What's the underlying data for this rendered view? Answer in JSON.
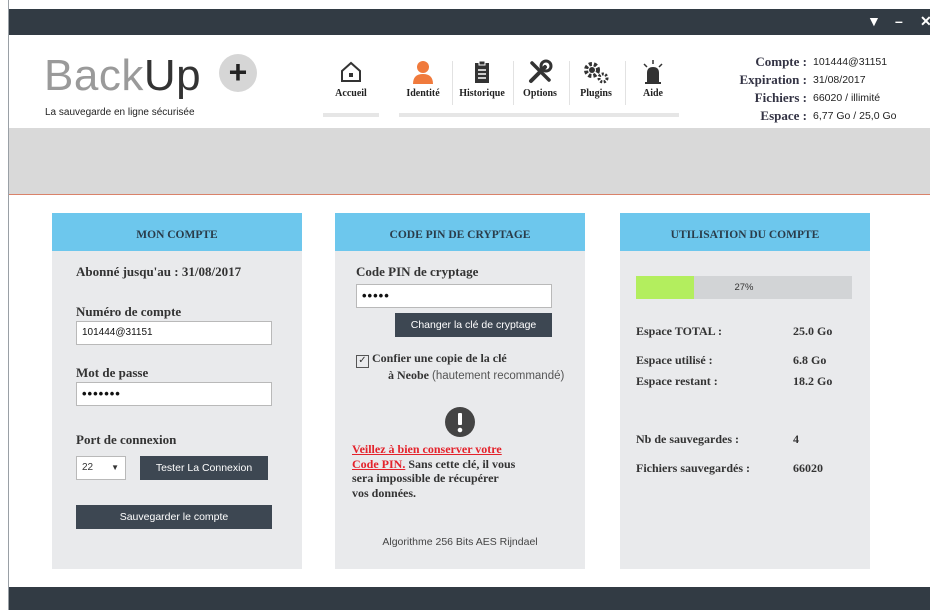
{
  "window": {
    "controls": [
      "▼",
      "–",
      "✕"
    ]
  },
  "app": {
    "name_light": "Back",
    "name_dark": "Up",
    "plus": "+",
    "tagline": "La sauvegarde en ligne sécurisée"
  },
  "nav": {
    "items": [
      {
        "label": "Accueil",
        "icon": "home-icon"
      },
      {
        "label": "Identité",
        "icon": "user-icon",
        "color": "#f07a3c"
      },
      {
        "label": "Historique",
        "icon": "clipboard-icon"
      },
      {
        "label": "Options",
        "icon": "tools-icon"
      },
      {
        "label": "Plugins",
        "icon": "gears-icon"
      },
      {
        "label": "Aide",
        "icon": "alarm-light-icon"
      }
    ]
  },
  "account_info": {
    "compte_label": "Compte :",
    "compte_value": "101444@31151",
    "expiration_label": "Expiration :",
    "expiration_value": "31/08/2017",
    "fichiers_label": "Fichiers :",
    "fichiers_value": "66020 / illimité",
    "espace_label": "Espace :",
    "espace_value": "6,77 Go / 25,0 Go"
  },
  "mon_compte": {
    "title": "MON COMPTE",
    "subscribed": "Abonné jusqu'au : 31/08/2017",
    "account_number_label": "Numéro de compte",
    "account_number_value": "101444@31151",
    "password_label": "Mot de passe",
    "password_value": "•••••••",
    "port_label": "Port de connexion",
    "port_value": "22",
    "test_button": "Tester La Connexion",
    "save_button": "Sauvegarder le compte"
  },
  "pin": {
    "title": "CODE PIN DE CRYPTAGE",
    "label": "Code PIN de cryptage",
    "value": "•••••",
    "change_button": "Changer la clé de cryptage",
    "checkbox_checked": true,
    "confide_line1": "Confier une copie de la clé",
    "confide_line2_bold": "à Neobe",
    "confide_line2_rest": "(hautement recommandé)",
    "warn_line1": "Veillez à bien conserver votre",
    "warn_line2_red": "Code PIN.",
    "warn_line2_rest": "Sans cette clé, il vous",
    "warn_line3": "sera impossible de récupérer",
    "warn_line4": "vos données.",
    "algorithm": "Algorithme 256 Bits AES Rijndael"
  },
  "usage": {
    "title": "UTILISATION DU COMPTE",
    "percent": 27,
    "percent_label": "27%",
    "total_label": "Espace TOTAL :",
    "total_value": "25.0 Go",
    "used_label": "Espace utilisé :",
    "used_value": "6.8 Go",
    "remaining_label": "Espace restant :",
    "remaining_value": "18.2 Go",
    "backups_label": "Nb de sauvegardes :",
    "backups_value": "4",
    "files_label": "Fichiers sauvegardés :",
    "files_value": "66020"
  }
}
